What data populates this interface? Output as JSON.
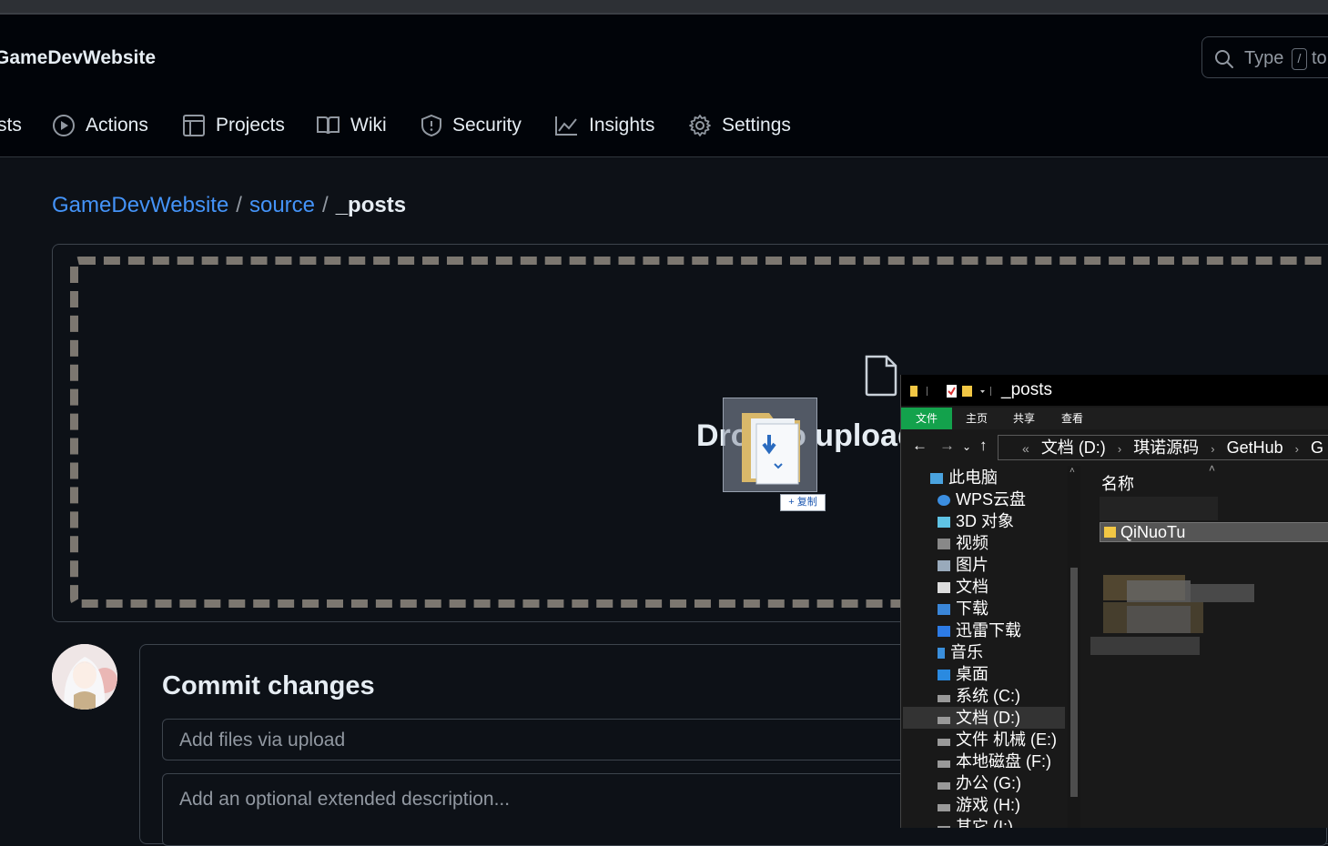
{
  "header": {
    "repo_name": "GameDevWebsite",
    "search_placeholder": "Type",
    "search_key": "/",
    "search_placeholder_tail": "to"
  },
  "nav": {
    "partial_item": "sts",
    "items": [
      {
        "label": "Actions",
        "icon": "play-circle-icon"
      },
      {
        "label": "Projects",
        "icon": "table-icon"
      },
      {
        "label": "Wiki",
        "icon": "book-icon"
      },
      {
        "label": "Security",
        "icon": "shield-icon"
      },
      {
        "label": "Insights",
        "icon": "graph-icon"
      },
      {
        "label": "Settings",
        "icon": "gear-icon"
      }
    ]
  },
  "breadcrumb": {
    "repo": "GameDevWebsite",
    "sep": "/",
    "folder": "source",
    "current": "_posts"
  },
  "upload": {
    "drop_text": "Drop to upload",
    "copy_badge": "+ 复制"
  },
  "commit": {
    "title": "Commit changes",
    "summary_placeholder": "Add files via upload",
    "description_placeholder": "Add an optional extended description..."
  },
  "explorer": {
    "title": "_posts",
    "tabs": [
      "文件",
      "主页",
      "共享",
      "查看"
    ],
    "path": [
      "文档 (D:)",
      "琪诺源码",
      "GetHub",
      "G"
    ],
    "path_prefix": "«",
    "column_header": "名称",
    "selected_folder": "QiNuoTu",
    "sidebar": [
      "此电脑",
      "WPS云盘",
      "3D 对象",
      "视频",
      "图片",
      "文档",
      "下载",
      "迅雷下载",
      "音乐",
      "桌面",
      "系统 (C:)",
      "文档 (D:)",
      "文件 机械 (E:)",
      "本地磁盘 (F:)",
      "办公 (G:)",
      "游戏 (H:)",
      "其它 (I:)"
    ],
    "selected_sidebar": "文档 (D:)"
  },
  "colors": {
    "bg": "#0d1117",
    "header_bg": "#010409",
    "link": "#4493f8",
    "border": "#3d444d",
    "explorer_tab_active": "#13a24c"
  }
}
